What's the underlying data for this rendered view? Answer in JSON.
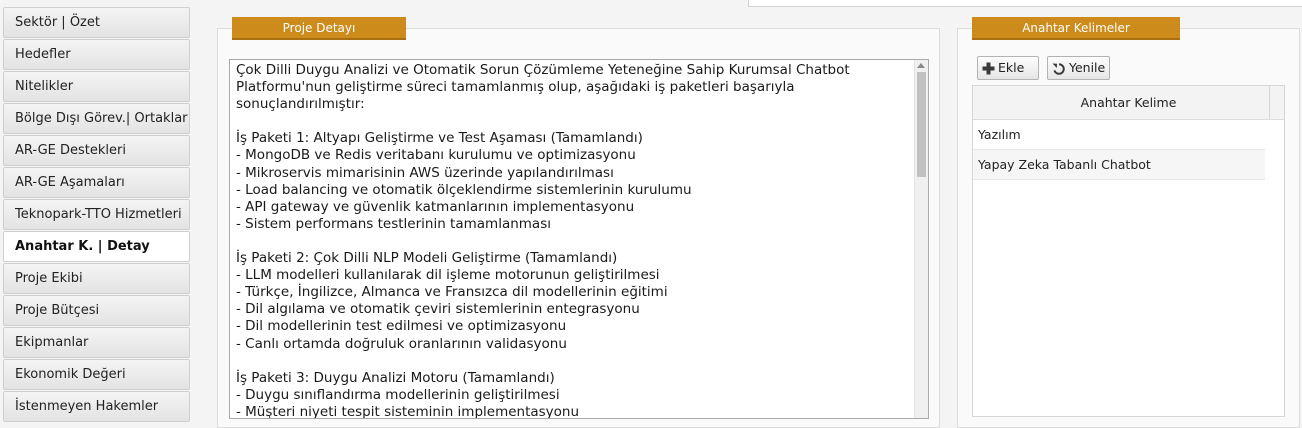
{
  "sidebar": {
    "items": [
      {
        "label": "Sektör | Özet"
      },
      {
        "label": "Hedefler"
      },
      {
        "label": "Nitelikler"
      },
      {
        "label": "Bölge Dışı Görev.| Ortaklar"
      },
      {
        "label": "AR-GE Destekleri"
      },
      {
        "label": "AR-GE Aşamaları"
      },
      {
        "label": "Teknopark-TTO Hizmetleri"
      },
      {
        "label": "Anahtar K. | Detay"
      },
      {
        "label": "Proje Ekibi"
      },
      {
        "label": "Proje Bütçesi"
      },
      {
        "label": "Ekipmanlar"
      },
      {
        "label": "Ekonomik Değeri"
      },
      {
        "label": "İstenmeyen Hakemler"
      }
    ],
    "active_index": 7
  },
  "detail": {
    "title": "Proje Detayı",
    "text": "Çok Dilli Duygu Analizi ve Otomatik Sorun Çözümleme Yeteneğine Sahip Kurumsal Chatbot\nPlatformu'nun geliştirme süreci tamamlanmış olup, aşağıdaki iş paketleri başarıyla\nsonuçlandırılmıştır:\n\nİş Paketi 1: Altyapı Geliştirme ve Test Aşaması (Tamamlandı)\n- MongoDB ve Redis veritabanı kurulumu ve optimizasyonu\n- Mikroservis mimarisinin AWS üzerinde yapılandırılması\n- Load balancing ve otomatik ölçeklendirme sistemlerinin kurulumu\n- API gateway ve güvenlik katmanlarının implementasyonu\n- Sistem performans testlerinin tamamlanması\n\nİş Paketi 2: Çok Dilli NLP Modeli Geliştirme (Tamamlandı)\n- LLM modelleri kullanılarak dil işleme motorunun geliştirilmesi\n- Türkçe, İngilizce, Almanca ve Fransızca dil modellerinin eğitimi\n- Dil algılama ve otomatik çeviri sistemlerinin entegrasyonu\n- Dil modellerinin test edilmesi ve optimizasyonu\n- Canlı ortamda doğruluk oranlarının validasyonu\n\nİş Paketi 3: Duygu Analizi Motoru (Tamamlandı)\n- Duygu sınıflandırma modellerinin geliştirilmesi\n- Müşteri niyeti tespit sisteminin implementasyonu"
  },
  "keywords": {
    "title": "Anahtar Kelimeler",
    "add_label": "Ekle",
    "refresh_label": "Yenile",
    "column_header": "Anahtar Kelime",
    "rows": [
      "Yazılım",
      "Yapay Zeka Tabanlı Chatbot"
    ]
  },
  "colors": {
    "ribbon": "#cc8b1b"
  }
}
